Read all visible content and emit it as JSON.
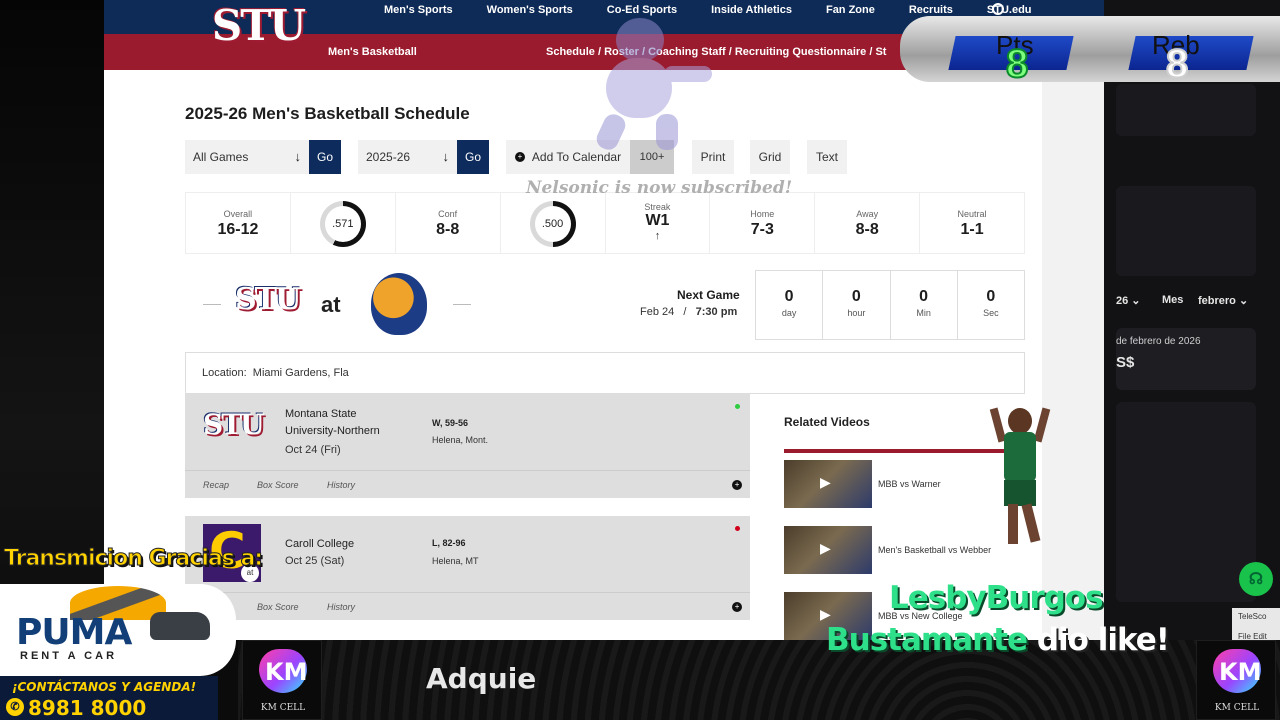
{
  "nav": {
    "links": [
      "Men's Sports",
      "Women's Sports",
      "Co-Ed Sports",
      "Inside Athletics",
      "Fan Zone",
      "Recruits",
      "STU.edu"
    ],
    "logo_text": "STU"
  },
  "subnav": {
    "section": "Men's Basketball",
    "crumbs": "Schedule  /  Roster  /  Coaching Staff  /  Recruiting Questionnaire  /  St"
  },
  "page": {
    "title": "2025-26 Men's Basketball Schedule"
  },
  "filters": {
    "games_select": "All Games",
    "season_select": "2025-26",
    "go_label": "Go",
    "add_calendar": "Add To Calendar",
    "badge": "100+",
    "print": "Print",
    "grid": "Grid",
    "text": "Text"
  },
  "record": {
    "overall_label": "Overall",
    "overall": "16-12",
    "overall_pct": ".571",
    "overall_pct_value": 0.571,
    "conf_label": "Conf",
    "conf": "8-8",
    "conf_pct": ".500",
    "conf_pct_value": 0.5,
    "streak_label": "Streak",
    "streak": "W1",
    "streak_arrow": "↑",
    "home_label": "Home",
    "home": "7-3",
    "away_label": "Away",
    "away": "8-8",
    "neutral_label": "Neutral",
    "neutral": "1-1"
  },
  "next_game": {
    "at": "at",
    "label": "Next Game",
    "date": "Feb 24",
    "sep": "/",
    "time": "7:30 pm",
    "countdown": [
      {
        "num": "0",
        "unit": "day"
      },
      {
        "num": "0",
        "unit": "hour"
      },
      {
        "num": "0",
        "unit": "Min"
      },
      {
        "num": "0",
        "unit": "Sec"
      }
    ],
    "location_label": "Location:",
    "location": "Miami Gardens, Fla"
  },
  "games": [
    {
      "opponent": "Montana State University-Northern",
      "date": "Oct 24 (Fri)",
      "result": "W, 59-56",
      "place": "Helena, Mont.",
      "links": [
        "Recap",
        "Box Score",
        "History"
      ],
      "dot_color": "#2ecc40"
    },
    {
      "opponent": "Caroll College",
      "date": "Oct 25 (Sat)",
      "result": "L, 82-96",
      "place": "Helena, MT",
      "links": [
        "Box Score",
        "History"
      ],
      "dot_color": "#d0021b",
      "logo_tag": "at"
    }
  ],
  "related": {
    "title": "Related Videos",
    "videos": [
      "MBB vs Warner",
      "Men's Basketball vs Webber",
      "MBB vs New College"
    ]
  },
  "overlay": {
    "subscribed": "Nelsonic is now subscribed!",
    "pts_label": "Pts",
    "pts_value": "8",
    "reb_label": "Reb",
    "reb_value": "8",
    "like_name_1": "LesbyBurgos",
    "like_name_2": "Bustamante",
    "like_suffix": "dio like!",
    "ticker": "Adquie",
    "km_logo_text": "KM CELL",
    "km_mark": "KM",
    "sponsor_header": "Transmicion Gracias a:",
    "sponsor_brand": "PUMA",
    "sponsor_sub": "RENT A CAR",
    "sponsor_cta": "¡CONTÁCTANOS Y AGENDA!",
    "sponsor_phone": "8981 8000"
  },
  "right_panel": {
    "year_dd": "26",
    "month_label": "Mes",
    "month_dd": "febrero",
    "date_text": "de febrero de 2026",
    "amount": "S$"
  },
  "telescope": {
    "title": "TeleSco",
    "menu": "File   Edit"
  },
  "colors": {
    "navy": "#0e2b57",
    "crimson": "#9b1b2e",
    "like_green": "#2ee08a",
    "score_blue": "#1f4ac8",
    "sponsor_yellow": "#ffd200"
  }
}
